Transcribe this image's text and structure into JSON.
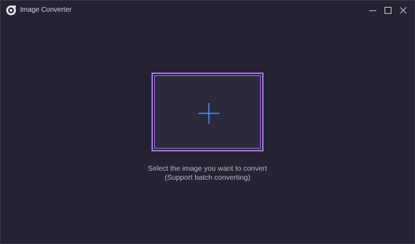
{
  "window": {
    "title": "Image Converter",
    "app_icon": "camera-lens-icon",
    "controls": {
      "minimize_icon": "minimize-icon",
      "maximize_icon": "maximize-icon",
      "close_icon": "close-icon"
    }
  },
  "main": {
    "drop_zone_icon": "plus-icon",
    "hint_primary": "Select the image you want to convert",
    "hint_secondary": "(Support batch converting)"
  },
  "colors": {
    "background": "#242333",
    "accent": "#a978e6",
    "plus": "#5b8ff0",
    "text": "#b9b9c6"
  }
}
